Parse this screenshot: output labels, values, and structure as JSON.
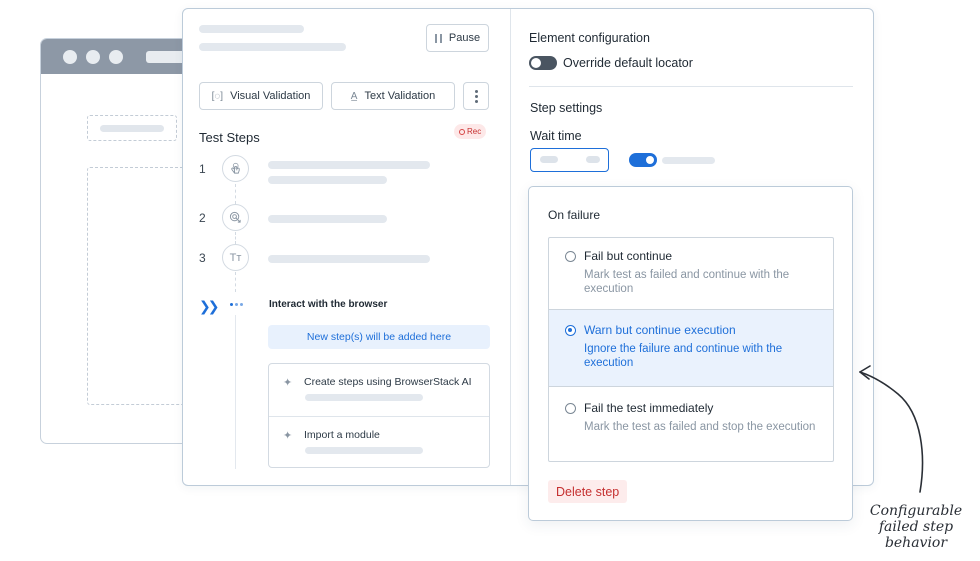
{
  "toolbar": {
    "pause_label": "Pause",
    "visual_validation_label": "Visual Validation",
    "text_validation_label": "Text Validation"
  },
  "steps": {
    "title": "Test Steps",
    "rec_badge": "Rec",
    "items": [
      {
        "number": "1",
        "icon": "touch-icon"
      },
      {
        "number": "2",
        "icon": "click-icon"
      },
      {
        "number": "3",
        "icon": "text-icon",
        "glyph": "Tт"
      }
    ],
    "interact_label": "Interact with the browser",
    "new_steps_hint": "New step(s) will be added here",
    "options": [
      {
        "label": "Create steps using BrowserStack AI"
      },
      {
        "label": "Import a module"
      }
    ]
  },
  "element_config": {
    "title": "Element configuration",
    "override_label": "Override default locator",
    "override_enabled": false
  },
  "step_settings": {
    "title": "Step settings",
    "wait_time_label": "Wait time",
    "wait_toggle_enabled": true
  },
  "on_failure": {
    "title": "On failure",
    "choices": [
      {
        "title": "Fail but continue",
        "description": "Mark test as failed and continue with the execution",
        "selected": false
      },
      {
        "title": "Warn but continue execution",
        "description": "Ignore the failure and continue with the execution",
        "selected": true
      },
      {
        "title": "Fail the test immediately",
        "description": "Mark the test as failed and stop the execution",
        "selected": false
      }
    ],
    "delete_label": "Delete step"
  },
  "annotation": {
    "line1": "Configurable",
    "line2": "failed step",
    "line3": "behavior"
  },
  "colors": {
    "accent": "#1e6fd9",
    "selected_bg": "#eaf2fd",
    "danger": "#c53030",
    "danger_bg": "#fdecec"
  }
}
